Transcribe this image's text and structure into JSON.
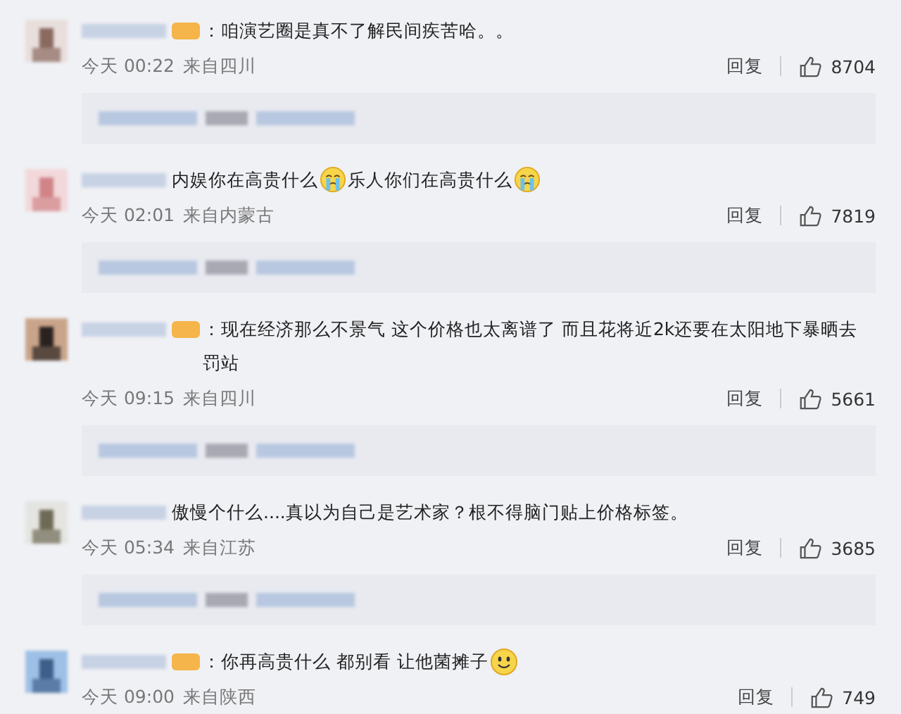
{
  "comments": [
    {
      "badge": true,
      "sep": "：",
      "parts": [
        {
          "kind": "text",
          "text": "咱演艺圈是真不了解民间疾苦哈。。"
        }
      ],
      "time": "今天 00:22",
      "location": "来自四川",
      "reply": "回复",
      "likes": "8704",
      "replies_preview": true
    },
    {
      "badge": false,
      "parts": [
        {
          "kind": "text",
          "text": "内娱你在高贵什么"
        },
        {
          "kind": "cry"
        },
        {
          "kind": "text",
          "text": "乐人你们在高贵什么"
        },
        {
          "kind": "cry"
        }
      ],
      "time": "今天 02:01",
      "location": "来自内蒙古",
      "reply": "回复",
      "likes": "7819",
      "replies_preview": true
    },
    {
      "badge": true,
      "sep": "：",
      "parts": [
        {
          "kind": "text",
          "text": "现在经济那么不景气 这个价格也太离谱了 而且花将近2k还要在太阳地下暴晒去罚站"
        }
      ],
      "time": "今天 09:15",
      "location": "来自四川",
      "reply": "回复",
      "likes": "5661",
      "replies_preview": true
    },
    {
      "badge": false,
      "parts": [
        {
          "kind": "text",
          "text": "傲慢个什么....真以为自己是艺术家？根不得脑门贴上价格标签。"
        }
      ],
      "time": "今天 05:34",
      "location": "来自江苏",
      "reply": "回复",
      "likes": "3685",
      "replies_preview": true
    },
    {
      "badge": true,
      "sep": "：",
      "parts": [
        {
          "kind": "text",
          "text": "你再高贵什么 都别看 让他菌摊子"
        },
        {
          "kind": "smile"
        }
      ],
      "time": "今天 09:00",
      "location": "来自陕西",
      "reply": "回复",
      "likes": "749",
      "replies_preview": false
    }
  ]
}
